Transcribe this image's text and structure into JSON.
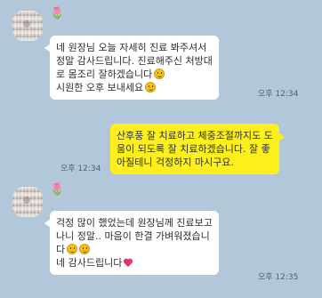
{
  "messages": [
    {
      "sender": "other",
      "nickname_icon": "tulip-icon",
      "lines": [
        "네 원장님 오늘 자세히 진료 봐주셔서",
        "정말 감사드립니다. 진료해주신 처방대",
        "로 몸조리 잘하겠습니다",
        "시원한 오후 보내세요"
      ],
      "time": "오후 12:34"
    },
    {
      "sender": "me",
      "lines": [
        "산후풍 잘 치료하고 체중조절까지도 도",
        "움이 되도록 잘 치료하겠습니다. 잘 좋",
        "아질테니 걱정하지 마시구요."
      ],
      "time": "오후 12:34"
    },
    {
      "sender": "other",
      "nickname_icon": "tulip-icon",
      "lines": [
        "걱정 많이 했었는데 원장님께 진료보고",
        "나니 정말.. 마음이 한결 가벼워졌습니",
        "다",
        "네 감사드립니다"
      ],
      "time": "오후 12:35"
    }
  ],
  "colors": {
    "background": "#b2c7da",
    "my_bubble": "#fef01b",
    "other_bubble": "#ffffff"
  }
}
